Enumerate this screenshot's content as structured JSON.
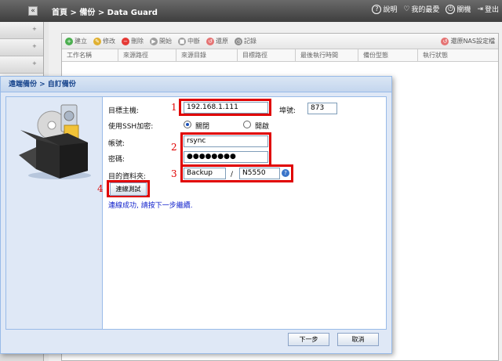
{
  "topbar": {
    "collapse_glyph": "«",
    "breadcrumb": "首頁 > 備份 > Data Guard",
    "help": "說明",
    "favorites": "我的最愛",
    "shutdown": "關機",
    "logout": "登出"
  },
  "toolbar": {
    "create": "建立",
    "edit": "修改",
    "delete": "刪除",
    "start": "開始",
    "stop": "中斷",
    "restore": "還原",
    "log": "記錄",
    "restore_nas_config": "還原NAS設定檔"
  },
  "grid": {
    "columns": [
      "工作名稱",
      "來源路徑",
      "來源目錄",
      "目標路徑",
      "最後執行時間",
      "備份型態",
      "執行狀態"
    ]
  },
  "dialog": {
    "title": "遠端備份 > 自訂備份",
    "target_host_label": "目標主機:",
    "target_host_value": "192.168.1.111",
    "port_label": "埠號:",
    "port_value": "873",
    "ssh_label": "使用SSH加密:",
    "ssh_off": "關閉",
    "ssh_on": "開啟",
    "account_label": "帳號:",
    "account_value": "rsync",
    "password_label": "密碼:",
    "password_value": "●●●●●●●●",
    "folder_label": "目的資料夾:",
    "folder_value": "Backup",
    "folder_sep": "/",
    "subfolder_value": "N5550",
    "test_button": "連線測試",
    "success_message": "連線成功, 請按下一步繼續.",
    "next_button": "下一步",
    "cancel_button": "取消"
  },
  "annotations": [
    "1",
    "2",
    "3",
    "4"
  ],
  "colors": {
    "highlight_red": "#e00000",
    "success_blue": "#1122cc",
    "dialog_bg": "#dfe8f6"
  }
}
